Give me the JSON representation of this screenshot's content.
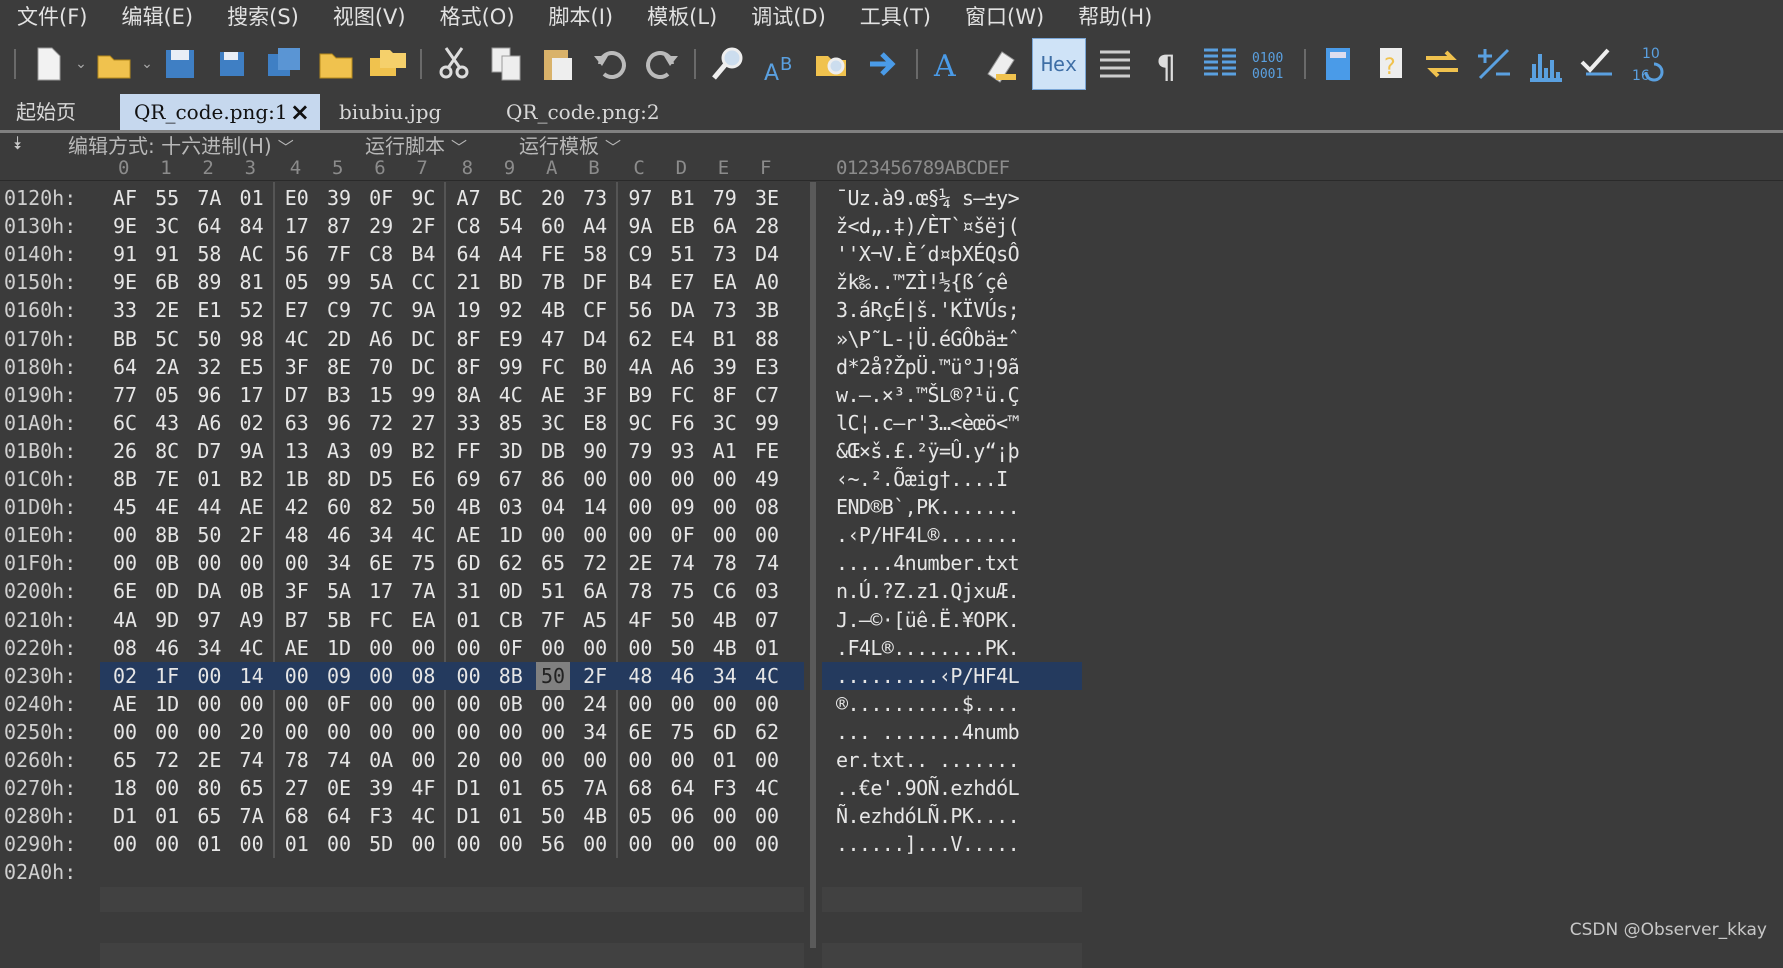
{
  "menu": [
    "文件(F)",
    "编辑(E)",
    "搜索(S)",
    "视图(V)",
    "格式(O)",
    "脚本(I)",
    "模板(L)",
    "调试(D)",
    "工具(T)",
    "窗口(W)",
    "帮助(H)"
  ],
  "toolbar": {
    "icons": [
      "new-file-icon",
      "open-folder-icon",
      "save-icon",
      "save-as-icon",
      "save-all-icon",
      "folder-icon",
      "folders-icon",
      "cut-icon",
      "copy-icon",
      "paste-icon",
      "undo-icon",
      "redo-icon",
      "find-icon",
      "replace-icon",
      "find-in-files-icon",
      "goto-icon",
      "font-icon",
      "highlight-icon",
      "hex-icon",
      "compare-icon",
      "pilcrow-icon",
      "columns-icon",
      "binary-icon",
      "calculator-icon",
      "template-help-icon",
      "swap-icon",
      "add-subtract-icon",
      "histogram-icon",
      "checksum-icon",
      "base-convert-icon"
    ],
    "hex_label": "Hex"
  },
  "tabs": {
    "home": "起始页",
    "active": "QR_code.png:1",
    "second": "biubiu.jpg",
    "third": "QR_code.png:2"
  },
  "options": {
    "edit_mode": "编辑方式: 十六进制(H)",
    "run_script": "运行脚本",
    "run_template": "运行模板"
  },
  "ruler": {
    "hex_columns": [
      "0",
      "1",
      "2",
      "3",
      "4",
      "5",
      "6",
      "7",
      "8",
      "9",
      "A",
      "B",
      "C",
      "D",
      "E",
      "F"
    ],
    "ascii_header": "0123456789ABCDEF"
  },
  "rows": [
    {
      "addr": "0120h:",
      "bytes": [
        "AF",
        "55",
        "7A",
        "01",
        "E0",
        "39",
        "0F",
        "9C",
        "A7",
        "BC",
        "20",
        "73",
        "97",
        "B1",
        "79",
        "3E"
      ],
      "ascii": "¯Uz.à9.œ§¼ s—±y>"
    },
    {
      "addr": "0130h:",
      "bytes": [
        "9E",
        "3C",
        "64",
        "84",
        "17",
        "87",
        "29",
        "2F",
        "C8",
        "54",
        "60",
        "A4",
        "9A",
        "EB",
        "6A",
        "28"
      ],
      "ascii": "ž<d„.‡)/ÈT`¤šëj("
    },
    {
      "addr": "0140h:",
      "bytes": [
        "91",
        "91",
        "58",
        "AC",
        "56",
        "7F",
        "C8",
        "B4",
        "64",
        "A4",
        "FE",
        "58",
        "C9",
        "51",
        "73",
        "D4"
      ],
      "ascii": "''X¬V.È´d¤þXÉQsÔ"
    },
    {
      "addr": "0150h:",
      "bytes": [
        "9E",
        "6B",
        "89",
        "81",
        "05",
        "99",
        "5A",
        "CC",
        "21",
        "BD",
        "7B",
        "DF",
        "B4",
        "E7",
        "EA",
        "A0"
      ],
      "ascii": "žk‰..™ZÌ!½{ß´çê "
    },
    {
      "addr": "0160h:",
      "bytes": [
        "33",
        "2E",
        "E1",
        "52",
        "E7",
        "C9",
        "7C",
        "9A",
        "19",
        "92",
        "4B",
        "CF",
        "56",
        "DA",
        "73",
        "3B"
      ],
      "ascii": "3.áRçÉ|š.'KÏVÚs;"
    },
    {
      "addr": "0170h:",
      "bytes": [
        "BB",
        "5C",
        "50",
        "98",
        "4C",
        "2D",
        "A6",
        "DC",
        "8F",
        "E9",
        "47",
        "D4",
        "62",
        "E4",
        "B1",
        "88"
      ],
      "ascii": "»\\P˜L-¦Ü.éGÔbä±ˆ"
    },
    {
      "addr": "0180h:",
      "bytes": [
        "64",
        "2A",
        "32",
        "E5",
        "3F",
        "8E",
        "70",
        "DC",
        "8F",
        "99",
        "FC",
        "B0",
        "4A",
        "A6",
        "39",
        "E3"
      ],
      "ascii": "d*2å?ŽpÜ.™ü°J¦9ã"
    },
    {
      "addr": "0190h:",
      "bytes": [
        "77",
        "05",
        "96",
        "17",
        "D7",
        "B3",
        "15",
        "99",
        "8A",
        "4C",
        "AE",
        "3F",
        "B9",
        "FC",
        "8F",
        "C7"
      ],
      "ascii": "w.–.×³.™ŠL®?¹ü.Ç"
    },
    {
      "addr": "01A0h:",
      "bytes": [
        "6C",
        "43",
        "A6",
        "02",
        "63",
        "96",
        "72",
        "27",
        "33",
        "85",
        "3C",
        "E8",
        "9C",
        "F6",
        "3C",
        "99"
      ],
      "ascii": "lC¦.c–r'3…<èœö<™"
    },
    {
      "addr": "01B0h:",
      "bytes": [
        "26",
        "8C",
        "D7",
        "9A",
        "13",
        "A3",
        "09",
        "B2",
        "FF",
        "3D",
        "DB",
        "90",
        "79",
        "93",
        "A1",
        "FE"
      ],
      "ascii": "&Œ×š.£.²ÿ=Û.y“¡þ"
    },
    {
      "addr": "01C0h:",
      "bytes": [
        "8B",
        "7E",
        "01",
        "B2",
        "1B",
        "8D",
        "D5",
        "E6",
        "69",
        "67",
        "86",
        "00",
        "00",
        "00",
        "00",
        "49"
      ],
      "ascii": "‹~.².Õæig†....I"
    },
    {
      "addr": "01D0h:",
      "bytes": [
        "45",
        "4E",
        "44",
        "AE",
        "42",
        "60",
        "82",
        "50",
        "4B",
        "03",
        "04",
        "14",
        "00",
        "09",
        "00",
        "08"
      ],
      "ascii": "END®B`,PK......."
    },
    {
      "addr": "01E0h:",
      "bytes": [
        "00",
        "8B",
        "50",
        "2F",
        "48",
        "46",
        "34",
        "4C",
        "AE",
        "1D",
        "00",
        "00",
        "00",
        "0F",
        "00",
        "00"
      ],
      "ascii": ".‹P/HF4L®......."
    },
    {
      "addr": "01F0h:",
      "bytes": [
        "00",
        "0B",
        "00",
        "00",
        "00",
        "34",
        "6E",
        "75",
        "6D",
        "62",
        "65",
        "72",
        "2E",
        "74",
        "78",
        "74"
      ],
      "ascii": ".....4number.txt"
    },
    {
      "addr": "0200h:",
      "bytes": [
        "6E",
        "0D",
        "DA",
        "0B",
        "3F",
        "5A",
        "17",
        "7A",
        "31",
        "0D",
        "51",
        "6A",
        "78",
        "75",
        "C6",
        "03"
      ],
      "ascii": "n.Ú.?Z.z1.QjxuÆ."
    },
    {
      "addr": "0210h:",
      "bytes": [
        "4A",
        "9D",
        "97",
        "A9",
        "B7",
        "5B",
        "FC",
        "EA",
        "01",
        "CB",
        "7F",
        "A5",
        "4F",
        "50",
        "4B",
        "07"
      ],
      "ascii": "J.—©·[üê.Ë.¥OPK."
    },
    {
      "addr": "0220h:",
      "bytes": [
        "08",
        "46",
        "34",
        "4C",
        "AE",
        "1D",
        "00",
        "00",
        "00",
        "0F",
        "00",
        "00",
        "00",
        "50",
        "4B",
        "01"
      ],
      "ascii": ".F4L®........PK."
    },
    {
      "addr": "0230h:",
      "bytes": [
        "02",
        "1F",
        "00",
        "14",
        "00",
        "09",
        "00",
        "08",
        "00",
        "8B",
        "50",
        "2F",
        "48",
        "46",
        "34",
        "4C"
      ],
      "ascii": ".........‹P/HF4L",
      "selected": true,
      "cursor": 10
    },
    {
      "addr": "0240h:",
      "bytes": [
        "AE",
        "1D",
        "00",
        "00",
        "00",
        "0F",
        "00",
        "00",
        "00",
        "0B",
        "00",
        "24",
        "00",
        "00",
        "00",
        "00"
      ],
      "ascii": "®..........$...."
    },
    {
      "addr": "0250h:",
      "bytes": [
        "00",
        "00",
        "00",
        "20",
        "00",
        "00",
        "00",
        "00",
        "00",
        "00",
        "00",
        "34",
        "6E",
        "75",
        "6D",
        "62"
      ],
      "ascii": "... .......4numb"
    },
    {
      "addr": "0260h:",
      "bytes": [
        "65",
        "72",
        "2E",
        "74",
        "78",
        "74",
        "0A",
        "00",
        "20",
        "00",
        "00",
        "00",
        "00",
        "00",
        "01",
        "00"
      ],
      "ascii": "er.txt.. ......."
    },
    {
      "addr": "0270h:",
      "bytes": [
        "18",
        "00",
        "80",
        "65",
        "27",
        "0E",
        "39",
        "4F",
        "D1",
        "01",
        "65",
        "7A",
        "68",
        "64",
        "F3",
        "4C"
      ],
      "ascii": "..€e'.9OÑ.ezhdóL"
    },
    {
      "addr": "0280h:",
      "bytes": [
        "D1",
        "01",
        "65",
        "7A",
        "68",
        "64",
        "F3",
        "4C",
        "D1",
        "01",
        "50",
        "4B",
        "05",
        "06",
        "00",
        "00"
      ],
      "ascii": "Ñ.ezhdóLÑ.PK...."
    },
    {
      "addr": "0290h:",
      "bytes": [
        "00",
        "00",
        "01",
        "00",
        "01",
        "00",
        "5D",
        "00",
        "00",
        "00",
        "56",
        "00",
        "00",
        "00",
        "00",
        "00"
      ],
      "ascii": "......]...V....."
    },
    {
      "addr": "02A0h:",
      "bytes": [],
      "ascii": ""
    }
  ],
  "watermark": "CSDN @Observer_kkay"
}
